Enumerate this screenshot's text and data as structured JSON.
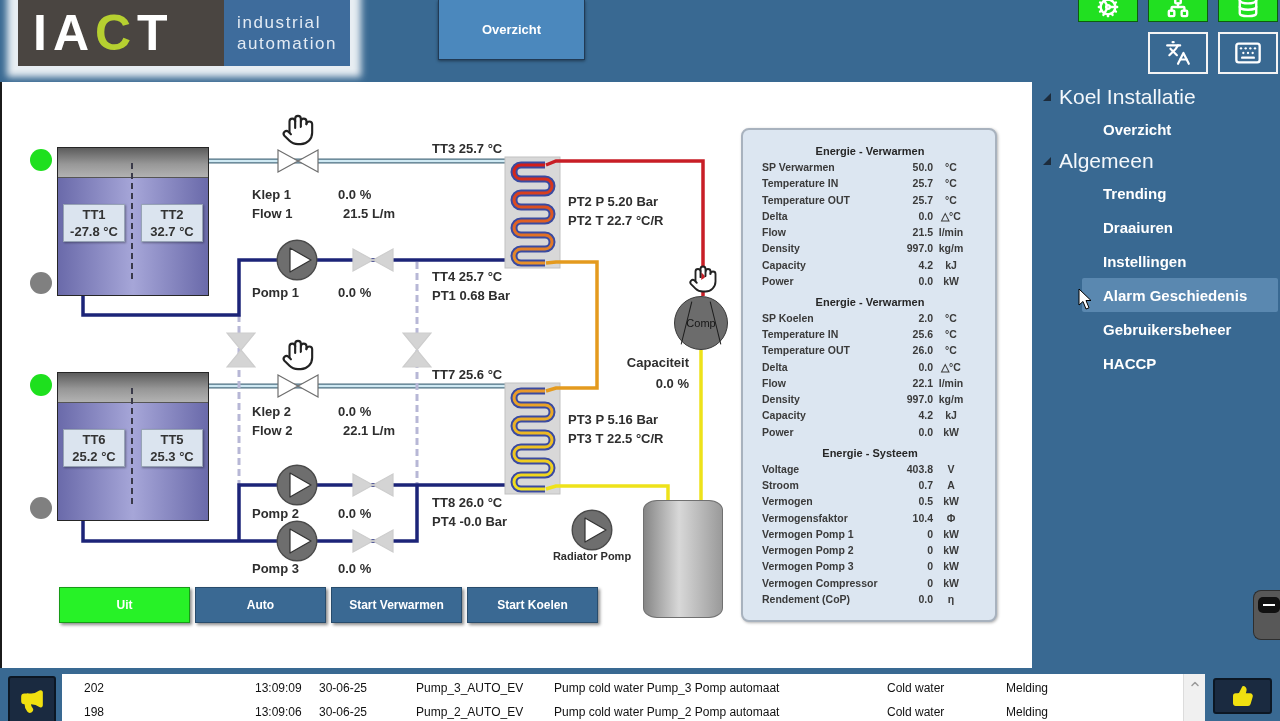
{
  "header": {
    "logo": {
      "wordmark": [
        {
          "text": "IA",
          "accent": false
        },
        {
          "text": "C",
          "accent": true
        },
        {
          "text": "T",
          "accent": false
        }
      ],
      "tagline": [
        "industrial",
        "automation"
      ]
    },
    "nav_button": {
      "label": "Overzicht"
    }
  },
  "diagram": {
    "tanks": [
      {
        "lamps": [
          {
            "color": "#1ee01e"
          },
          {
            "color": "#808080"
          }
        ],
        "sensors": [
          {
            "name": "TT1",
            "value": "-27.8 °C"
          },
          {
            "name": "TT2",
            "value": "32.7 °C"
          }
        ]
      },
      {
        "lamps": [
          {
            "color": "#1ee01e"
          },
          {
            "color": "#808080"
          }
        ],
        "sensors": [
          {
            "name": "TT6",
            "value": "25.2 °C"
          },
          {
            "name": "TT5",
            "value": "25.3 °C"
          }
        ]
      }
    ],
    "valves": [
      {
        "label": "Klep 1",
        "value": "0.0 %",
        "flow_label": "Flow 1",
        "flow_value": "21.5 L/m",
        "manual": true
      },
      {
        "label": "Klep 2",
        "value": "0.0 %",
        "flow_label": "Flow 2",
        "flow_value": "22.1 L/m",
        "manual": true
      }
    ],
    "pumps": [
      {
        "label": "Pomp 1",
        "value": "0.0 %",
        "running": false
      },
      {
        "label": "Pomp 2",
        "value": "0.0 %",
        "running": false
      },
      {
        "label": "Pomp 3",
        "value": "0.0 %",
        "running": false
      }
    ],
    "heat_exchangers": [
      {
        "inlet": "TT3 25.7 °C",
        "pressure": "PT2 P 5.20 Bar",
        "temperature": "PT2 T 22.7 °C/R",
        "outlet": "TT4 25.7 °C",
        "outlet_pressure": "PT1 0.68 Bar"
      },
      {
        "inlet": "TT7 25.6 °C",
        "pressure": "PT3 P 5.16 Bar",
        "temperature": "PT3 T 22.5 °C/R",
        "outlet": "TT8 26.0 °C",
        "outlet_pressure": "PT4 -0.0 Bar"
      }
    ],
    "compressor": {
      "label": "Comp",
      "running": false,
      "manual": true,
      "capacity_label": "Capaciteit",
      "capacity_value": "0.0 %"
    },
    "radiator_pump": {
      "label": "Radiator Pomp",
      "running": false
    }
  },
  "mode_buttons": [
    {
      "label": "Uit",
      "selected": true
    },
    {
      "label": "Auto",
      "selected": false
    },
    {
      "label": "Start Verwarmen",
      "selected": false
    },
    {
      "label": "Start Koelen",
      "selected": false
    }
  ],
  "energy_panel": {
    "sections": [
      {
        "title": "Energie - Verwarmen",
        "rows": [
          {
            "label": "SP Verwarmen",
            "value": "50.0",
            "unit": "°C"
          },
          {
            "label": "Temperature IN",
            "value": "25.7",
            "unit": "°C"
          },
          {
            "label": "Temperature OUT",
            "value": "25.7",
            "unit": "°C"
          },
          {
            "label": "Delta",
            "value": "0.0",
            "unit": "△°C"
          },
          {
            "label": "Flow",
            "value": "21.5",
            "unit": "l/min"
          },
          {
            "label": "Density",
            "value": "997.0",
            "unit": "kg/m"
          },
          {
            "label": "Capacity",
            "value": "4.2",
            "unit": "kJ"
          },
          {
            "label": "Power",
            "value": "0.0",
            "unit": "kW"
          }
        ]
      },
      {
        "title": "Energie - Verwarmen",
        "rows": [
          {
            "label": "SP Koelen",
            "value": "2.0",
            "unit": "°C"
          },
          {
            "label": "Temperature IN",
            "value": "25.6",
            "unit": "°C"
          },
          {
            "label": "Temperature OUT",
            "value": "26.0",
            "unit": "°C"
          },
          {
            "label": "Delta",
            "value": "0.0",
            "unit": "△°C"
          },
          {
            "label": "Flow",
            "value": "22.1",
            "unit": "l/min"
          },
          {
            "label": "Density",
            "value": "997.0",
            "unit": "kg/m"
          },
          {
            "label": "Capacity",
            "value": "4.2",
            "unit": "kJ"
          },
          {
            "label": "Power",
            "value": "0.0",
            "unit": "kW"
          }
        ]
      },
      {
        "title": "Energie - Systeem",
        "rows": [
          {
            "label": "Voltage",
            "value": "403.8",
            "unit": "V"
          },
          {
            "label": "Stroom",
            "value": "0.7",
            "unit": "A"
          },
          {
            "label": "Vermogen",
            "value": "0.5",
            "unit": "kW"
          },
          {
            "label": "Vermogensfaktor",
            "value": "10.4",
            "unit": "Φ"
          },
          {
            "label": "Vermogen Pomp 1",
            "value": "0",
            "unit": "kW"
          },
          {
            "label": "Vermogen Pomp 2",
            "value": "0",
            "unit": "kW"
          },
          {
            "label": "Vermogen Pomp 3",
            "value": "0",
            "unit": "kW"
          },
          {
            "label": "Vermogen Compressor",
            "value": "0",
            "unit": "kW"
          },
          {
            "label": "Rendement (CoP)",
            "value": "0.0",
            "unit": "η"
          }
        ]
      }
    ]
  },
  "sidebar": {
    "tree": [
      {
        "label": "Koel Installatie",
        "expanded": true,
        "children": [
          {
            "label": "Overzicht",
            "selected": false
          }
        ]
      },
      {
        "label": "Algemeen",
        "expanded": true,
        "children": [
          {
            "label": "Trending",
            "selected": false
          },
          {
            "label": "Draaiuren",
            "selected": false
          },
          {
            "label": "Instellingen",
            "selected": false
          },
          {
            "label": "Alarm Geschiedenis",
            "selected": true
          },
          {
            "label": "Gebruikersbeheer",
            "selected": false
          },
          {
            "label": "HACCP",
            "selected": false
          }
        ]
      }
    ]
  },
  "alarm_list": {
    "rows": [
      {
        "cells": [
          "202",
          "13:09:09",
          "30-06-25",
          "Pump_3_AUTO_EV",
          "Pump cold water Pump_3 Pomp automaat",
          "Cold water",
          "Melding"
        ]
      },
      {
        "cells": [
          "198",
          "13:09:06",
          "30-06-25",
          "Pump_2_AUTO_EV",
          "Pump cold water Pump_2 Pomp automaat",
          "Cold water",
          "Melding"
        ]
      }
    ]
  }
}
